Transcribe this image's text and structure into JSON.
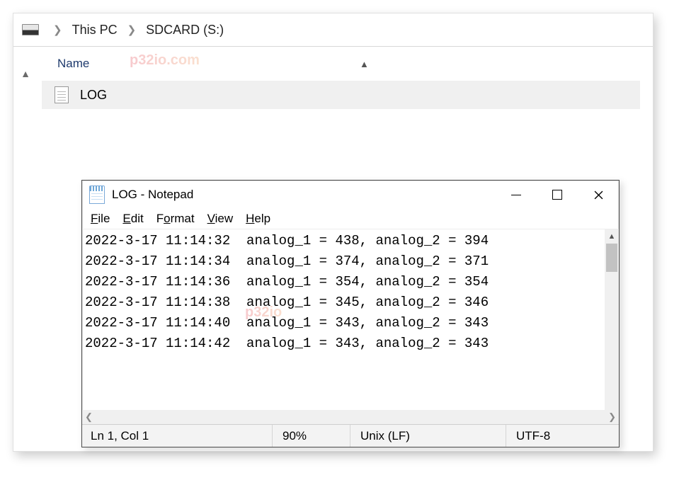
{
  "breadcrumb": {
    "items": [
      "This PC",
      "SDCARD (S:)"
    ]
  },
  "explorer": {
    "column_header": "Name",
    "file_name": "LOG"
  },
  "watermark": {
    "text_1": "p32io.com",
    "text_2": "p32io"
  },
  "notepad": {
    "title": "LOG - Notepad",
    "menu": {
      "file": "File",
      "edit": "Edit",
      "format": "Format",
      "view": "View",
      "help": "Help"
    },
    "log_lines": [
      "2022-3-17 11:14:32  analog_1 = 438, analog_2 = 394",
      "2022-3-17 11:14:34  analog_1 = 374, analog_2 = 371",
      "2022-3-17 11:14:36  analog_1 = 354, analog_2 = 354",
      "2022-3-17 11:14:38  analog_1 = 345, analog_2 = 346",
      "2022-3-17 11:14:40  analog_1 = 343, analog_2 = 343",
      "2022-3-17 11:14:42  analog_1 = 343, analog_2 = 343"
    ],
    "status": {
      "cursor": "Ln 1, Col 1",
      "zoom": "90%",
      "eol": "Unix (LF)",
      "encoding": "UTF-8"
    }
  }
}
